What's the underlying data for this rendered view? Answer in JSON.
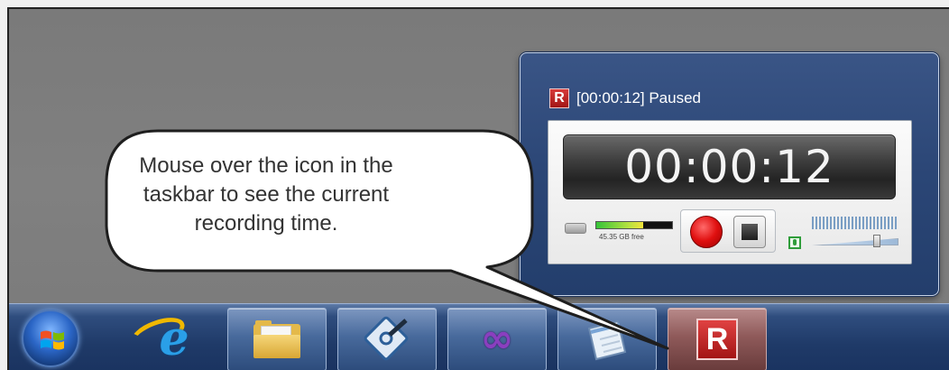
{
  "preview": {
    "app_icon_letter": "R",
    "title": "[00:00:12] Paused",
    "recorder": {
      "elapsed_time": "00:00:12",
      "disk_free": "45.35 GB free",
      "disk_level_fraction": 0.62
    }
  },
  "callout": {
    "text": "Mouse over the icon in the taskbar to see the current recording time."
  },
  "taskbar": {
    "items": [
      {
        "name": "start-button"
      },
      {
        "name": "internet-explorer",
        "glyph": "e"
      },
      {
        "name": "windows-explorer"
      },
      {
        "name": "expression-design"
      },
      {
        "name": "visual-studio",
        "glyph": "∞"
      },
      {
        "name": "notepad"
      },
      {
        "name": "recorder-app",
        "glyph": "R",
        "active": true
      }
    ]
  },
  "colors": {
    "taskbar": "#1f3a68",
    "preview_bg": "#2b4676",
    "record_red": "#e01010",
    "app_red": "#c02020"
  }
}
